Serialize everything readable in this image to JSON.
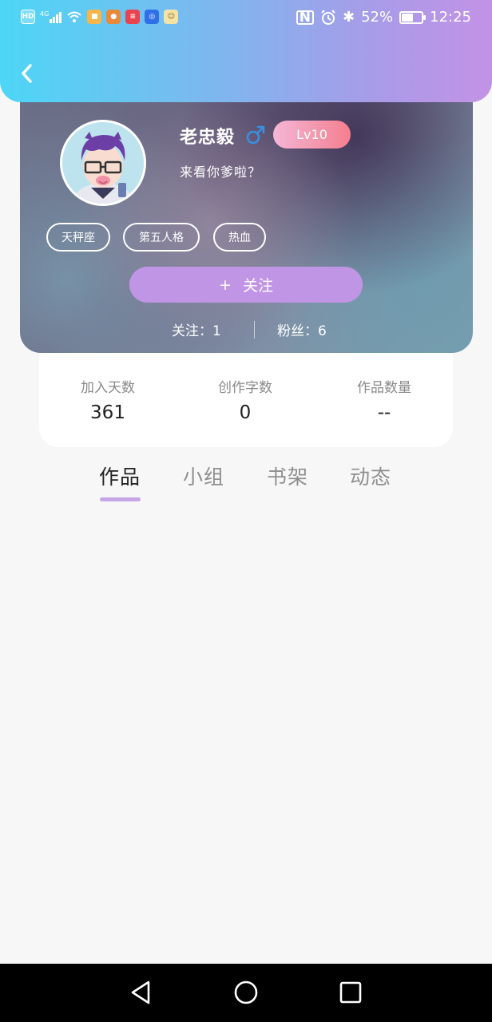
{
  "status_bar": {
    "battery": "52%",
    "time": "12:25",
    "network": "4G",
    "hd_label": "HD"
  },
  "profile": {
    "username": "老忠毅",
    "level": "Lv10",
    "bio": "来看你爹啦？",
    "tags": [
      "天秤座",
      "第五人格",
      "热血"
    ],
    "follow_button": {
      "icon": "+",
      "label": "关注"
    },
    "following": "关注：1",
    "fans": "粉丝：6"
  },
  "stats": [
    {
      "label": "加入天数",
      "value": "361"
    },
    {
      "label": "创作字数",
      "value": "0"
    },
    {
      "label": "作品数量",
      "value": "--"
    }
  ],
  "tabs": [
    {
      "label": "作品",
      "active": true
    },
    {
      "label": "小组",
      "active": false
    },
    {
      "label": "书架",
      "active": false
    },
    {
      "label": "动态",
      "active": false
    }
  ],
  "colors": {
    "accent": "#c195e6",
    "level_badge": "#f47f8f",
    "gender_icon": "#3a8fe0"
  }
}
